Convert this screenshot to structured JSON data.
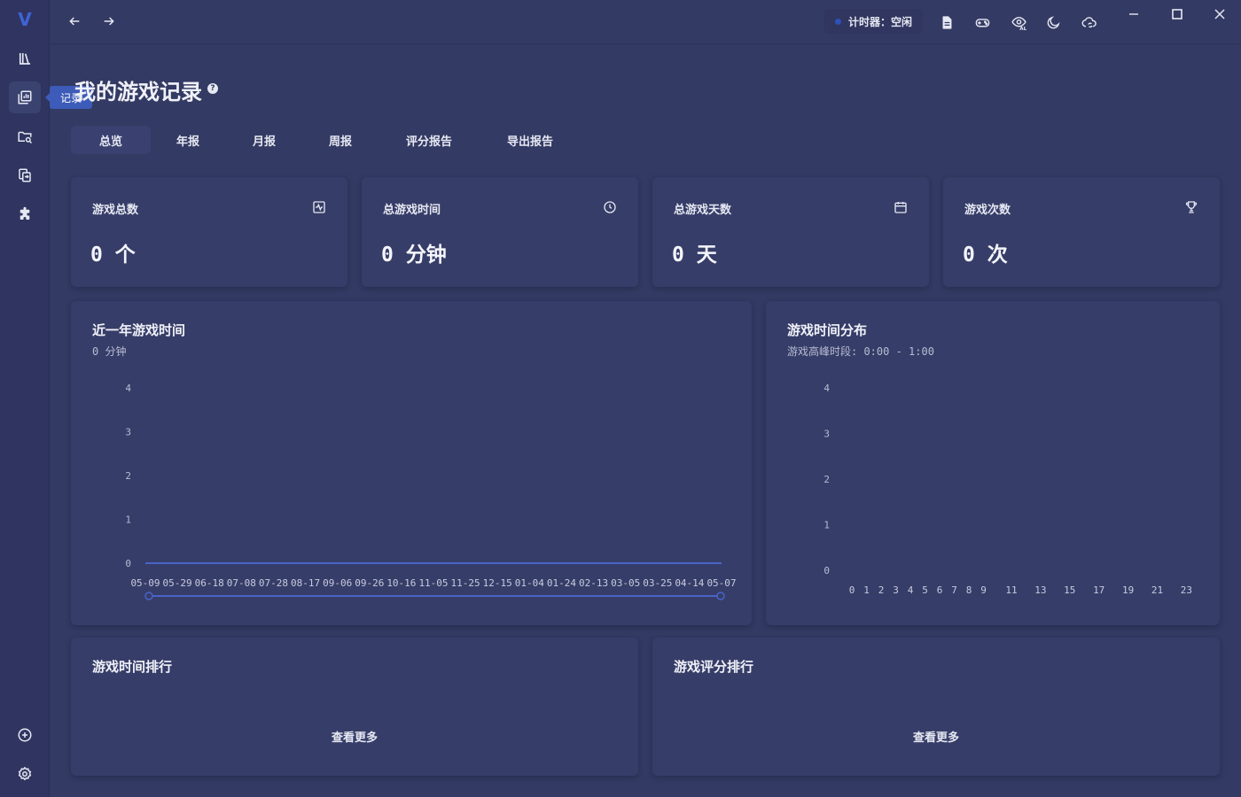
{
  "app": {
    "logo": "V"
  },
  "sidebar": {
    "items": [
      {
        "name": "library",
        "icon": "library-icon"
      },
      {
        "name": "record",
        "icon": "chart-icon",
        "tooltip": "记录"
      },
      {
        "name": "scan",
        "icon": "folder-search-icon"
      },
      {
        "name": "transfer",
        "icon": "transfer-icon"
      },
      {
        "name": "plugins",
        "icon": "puzzle-icon"
      }
    ],
    "bottom": [
      {
        "name": "add",
        "icon": "plus-circle-icon"
      },
      {
        "name": "settings",
        "icon": "gear-icon"
      }
    ]
  },
  "topbar": {
    "timer_label": "计时器：空闲",
    "timer_color": "#2c52b8"
  },
  "page": {
    "title": "我的游戏记录",
    "tabs": [
      "总览",
      "年报",
      "月报",
      "周报",
      "评分报告",
      "导出报告"
    ],
    "active_tab": "总览"
  },
  "stats": [
    {
      "label": "游戏总数",
      "value": "0 个",
      "icon": "activity-icon"
    },
    {
      "label": "总游戏时间",
      "value": "0 分钟",
      "icon": "clock-icon"
    },
    {
      "label": "总游戏天数",
      "value": "0 天",
      "icon": "calendar-icon"
    },
    {
      "label": "游戏次数",
      "value": "0 次",
      "icon": "trophy-icon"
    }
  ],
  "panels": {
    "yearly": {
      "title": "近一年游戏时间",
      "subtitle": "0 分钟"
    },
    "distribution": {
      "title": "游戏时间分布",
      "subtitle": "游戏高峰时段: 0:00 - 1:00"
    },
    "time_rank": {
      "title": "游戏时间排行",
      "more": "查看更多"
    },
    "score_rank": {
      "title": "游戏评分排行",
      "more": "查看更多"
    }
  },
  "chart_data": [
    {
      "type": "line",
      "title": "近一年游戏时间",
      "x": [
        "05-09",
        "05-29",
        "06-18",
        "07-08",
        "07-28",
        "08-17",
        "09-06",
        "09-26",
        "10-16",
        "11-05",
        "11-25",
        "12-15",
        "01-04",
        "01-24",
        "02-13",
        "03-05",
        "03-25",
        "04-14",
        "05-07"
      ],
      "series": [
        {
          "values": [
            0,
            0,
            0,
            0,
            0,
            0,
            0,
            0,
            0,
            0,
            0,
            0,
            0,
            0,
            0,
            0,
            0,
            0,
            0
          ]
        }
      ],
      "yticks": [
        0,
        1,
        2,
        3,
        4
      ],
      "ylim": [
        0,
        4
      ],
      "color": "#4a63c9"
    },
    {
      "type": "bar",
      "title": "游戏时间分布",
      "xticks": [
        "0",
        "1",
        "2",
        "3",
        "4",
        "5",
        "6",
        "7",
        "8",
        "9",
        "11",
        "13",
        "15",
        "17",
        "19",
        "21",
        "23"
      ],
      "values": [
        0,
        0,
        0,
        0,
        0,
        0,
        0,
        0,
        0,
        0,
        0,
        0,
        0,
        0,
        0,
        0,
        0,
        0,
        0,
        0,
        0,
        0,
        0,
        0
      ],
      "yticks": [
        0,
        1,
        2,
        3,
        4
      ],
      "ylim": [
        0,
        4
      ]
    }
  ]
}
